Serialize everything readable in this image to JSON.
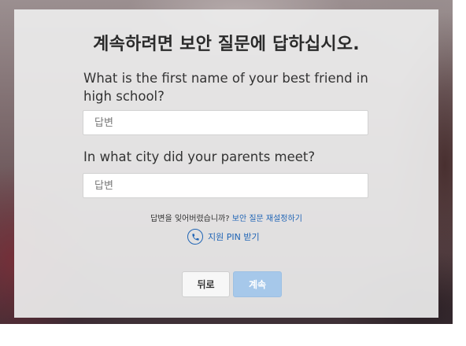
{
  "dialog": {
    "title": "계속하려면 보안 질문에 답하십시오.",
    "question1": "What is the first name of your best friend in high school?",
    "answer1_placeholder": "답변",
    "answer1_value": "",
    "question2": "In what city did your parents meet?",
    "answer2_placeholder": "답변",
    "answer2_value": "",
    "forgot_text": "답변을 잊어버렸습니까?",
    "reset_link": "보안 질문 재설정하기",
    "pin_icon": "phone-icon",
    "pin_label": "지원 PIN 받기",
    "back_button": "뒤로",
    "continue_button": "계속"
  },
  "colors": {
    "accent": "#1f64b5",
    "continue_disabled": "#a6c8ea",
    "panel": "#ececec"
  }
}
